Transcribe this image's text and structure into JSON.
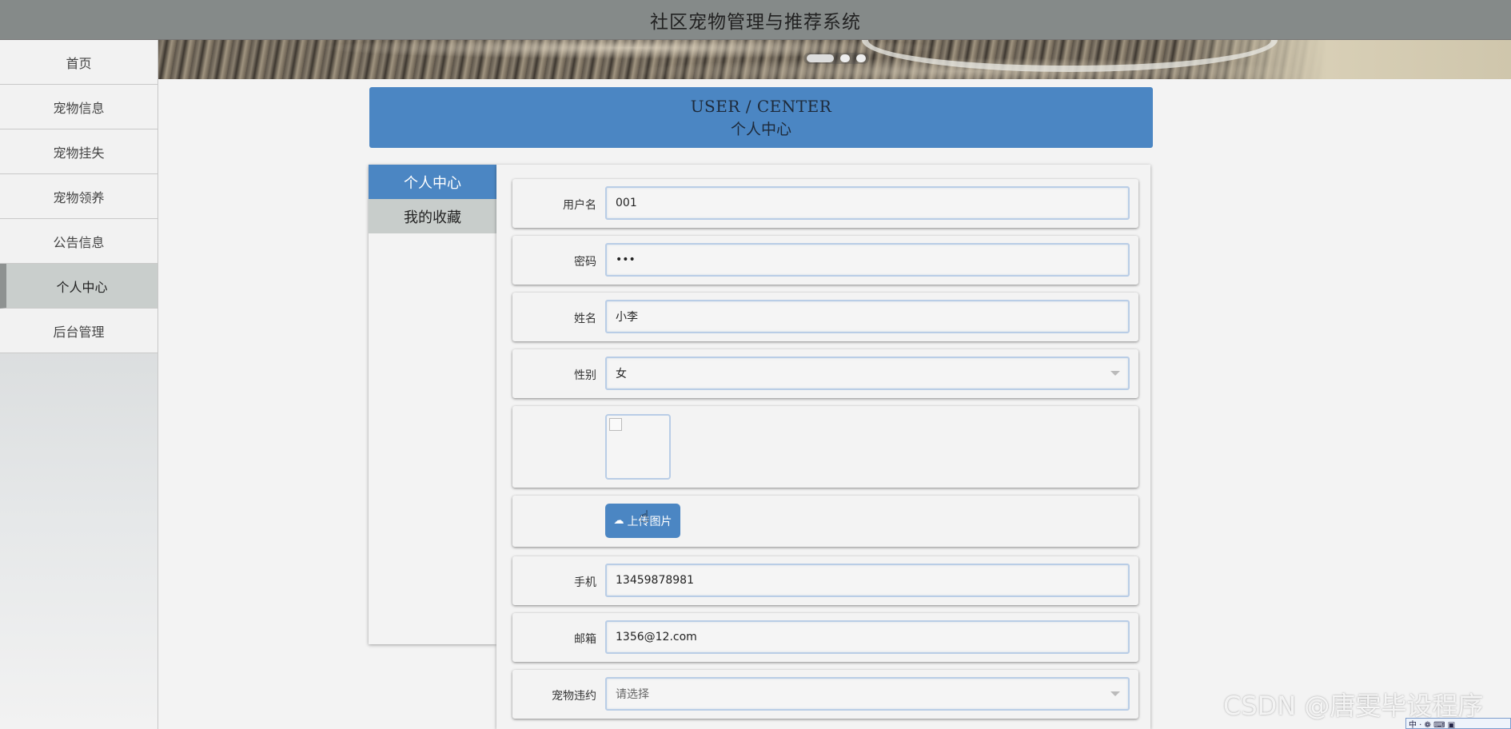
{
  "header": {
    "title": "社区宠物管理与推荐系统"
  },
  "sidebar": {
    "items": [
      {
        "label": "首页"
      },
      {
        "label": "宠物信息"
      },
      {
        "label": "宠物挂失"
      },
      {
        "label": "宠物领养"
      },
      {
        "label": "公告信息"
      },
      {
        "label": "个人中心",
        "active": true
      },
      {
        "label": "后台管理"
      }
    ]
  },
  "center": {
    "title_en": "USER / CENTER",
    "title_zh": "个人中心"
  },
  "tabs": [
    {
      "label": "个人中心",
      "active": true
    },
    {
      "label": "我的收藏",
      "active": false
    }
  ],
  "form": {
    "username": {
      "label": "用户名",
      "value": "001"
    },
    "password": {
      "label": "密码",
      "value": "•••"
    },
    "name": {
      "label": "姓名",
      "value": "小李"
    },
    "gender": {
      "label": "性别",
      "value": "女"
    },
    "upload": {
      "label": "上传图片",
      "icon": "cloud-upload-icon"
    },
    "phone": {
      "label": "手机",
      "value": "13459878981"
    },
    "email": {
      "label": "邮箱",
      "value": "1356@12.com"
    },
    "violation": {
      "label": "宠物违约",
      "value": "请选择"
    }
  },
  "watermark": "CSDN @唐雯毕设程序",
  "ime": {
    "text": "中 · ❁ ⌨ ▣"
  },
  "colors": {
    "accent": "#4b86c3",
    "header": "#858a89"
  }
}
